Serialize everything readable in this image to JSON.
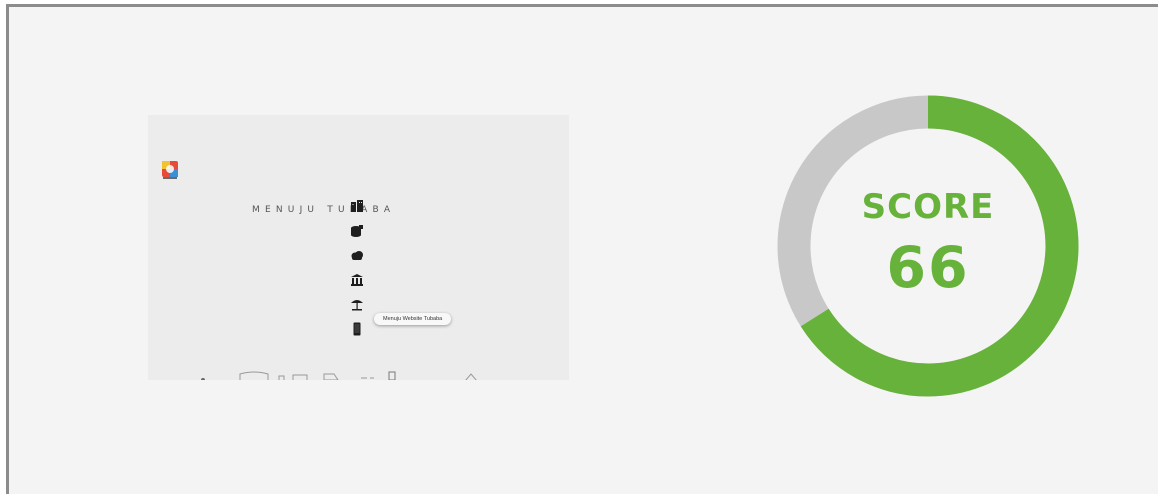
{
  "preview": {
    "headline": "MENUJU TUBABA",
    "tooltip": "Menuju Website Tubaba",
    "icons": [
      "app-logo-icon",
      "building-icon",
      "database-icon",
      "cloud-icon",
      "bank-icon",
      "beach-icon",
      "smartphone-icon"
    ]
  },
  "score": {
    "label": "SCORE",
    "value": "66",
    "fraction": 0.66,
    "color": "#67b23a",
    "track_color": "#c8c8c8"
  }
}
